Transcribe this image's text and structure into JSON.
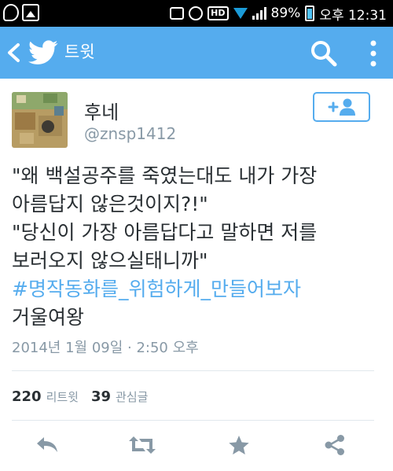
{
  "status_bar": {
    "battery": "89%",
    "time": "오후 12:31",
    "hd_label": "HD",
    "icons": [
      "g-icon",
      "image-icon",
      "vibrate-icon",
      "alarm-icon",
      "hd-icon",
      "wifi-icon",
      "signal-icon",
      "battery-icon"
    ]
  },
  "action_bar": {
    "title": "트윗",
    "background_color": "#55acee",
    "icons": [
      "back-icon",
      "twitter-bird-icon",
      "search-icon",
      "overflow-menu-icon"
    ]
  },
  "tweet": {
    "display_name": "후네",
    "screen_name": "@znsp1412",
    "follow_button_icon": "add-user-icon",
    "text_lines": [
      "\"왜 백설공주를 죽였는대도 내가 가장",
      "아름답지 않은것이지?!\"",
      "\"당신이 가장 아름답다고 말하면 저를",
      "보러오지 않으실태니까\""
    ],
    "hashtag": "#명작동화를_위험하게_만들어보자",
    "last_line": "거울여왕",
    "timestamp": "2014년 1월 09일 · 2:50 오후",
    "retweet_count": "220",
    "retweet_label": "리트윗",
    "favorite_count": "39",
    "favorite_label": "관심글"
  },
  "actions": [
    "reply-icon",
    "retweet-icon",
    "favorite-icon",
    "share-icon"
  ],
  "colors": {
    "accent": "#55acee",
    "text": "#292f33",
    "secondary_text": "#8899a6",
    "icon_gray": "#8899a6"
  }
}
